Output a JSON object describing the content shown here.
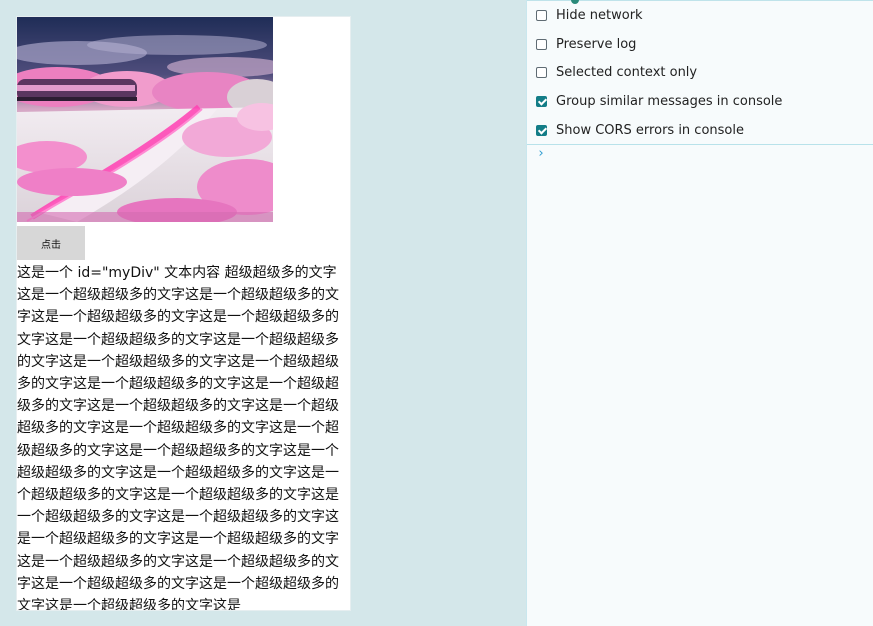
{
  "page": {
    "button_label": "点击",
    "text_content": "这是一个 id=\"myDiv\" 文本内容 超级超级多的文字这是一个超级超级多的文字这是一个超级超级多的文字这是一个超级超级多的文字这是一个超级超级多的文字这是一个超级超级多的文字这是一个超级超级多的文字这是一个超级超级多的文字这是一个超级超级多的文字这是一个超级超级多的文字这是一个超级超级多的文字这是一个超级超级多的文字这是一个超级超级多的文字这是一个超级超级多的文字这是一个超级超级多的文字这是一个超级超级多的文字这是一个超级超级多的文字这是一个超级超级多的文字这是一个超级超级多的文字这是一个超级超级多的文字这是一个超级超级多的文字这是一个超级超级多的文字这是一个超级超级多的文字这是一个超级超级多的文字这是一个超级超级多的文字这是一个超级超级多的文字这是一个超级超级多的文字这是一个超级超级多的文字这是一个超级超级多的文字这是"
  },
  "devtools": {
    "settings": [
      {
        "label": "Hide network",
        "checked": false
      },
      {
        "label": "Preserve log",
        "checked": false
      },
      {
        "label": "Selected context only",
        "checked": false
      },
      {
        "label": "Group similar messages in console",
        "checked": true
      },
      {
        "label": "Show CORS errors in console",
        "checked": true
      }
    ],
    "prompt_icon": "chevron-right-icon",
    "prompt_glyph": "›"
  },
  "colors": {
    "background": "#d4e7ea",
    "checkbox_checked": "#137d87",
    "prompt": "#2c9bd0"
  }
}
